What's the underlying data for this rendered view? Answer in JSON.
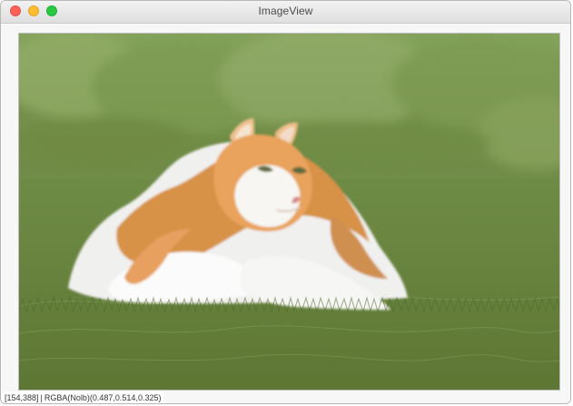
{
  "window": {
    "title": "ImageView"
  },
  "controls": {
    "close_icon": "close-icon",
    "minimize_icon": "minimize-icon",
    "zoom_icon": "zoom-icon"
  },
  "image": {
    "subject": "cat"
  },
  "status": {
    "coordinates": "[154,388]",
    "value": "RGBA(Nolb)(0.487,0.514,0.325)"
  },
  "colors": {
    "close": "#fe5f57",
    "minimize": "#febc2e",
    "zoom": "#28c840",
    "title_bar": "#e8e8e8",
    "window_bg": "#ececec"
  }
}
